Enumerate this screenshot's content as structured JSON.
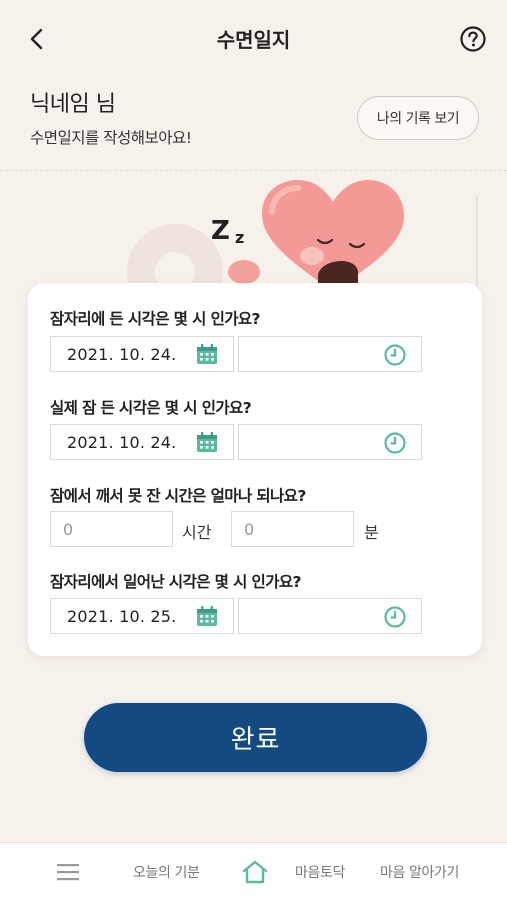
{
  "header": {
    "title": "수면일지"
  },
  "user": {
    "nickname": "닉네임 님",
    "subtitle": "수면일지를 작성해보아요!"
  },
  "records_button": "나의 기록 보기",
  "illustration": {
    "sleep_letters": [
      "Z",
      "z"
    ]
  },
  "form": {
    "q1": {
      "label": "잠자리에 든 시각은 몇 시 인가요?",
      "date": "2021. 10. 24.",
      "time": ""
    },
    "q2": {
      "label": "실제 잠 든 시각은 몇 시 인가요?",
      "date": "2021. 10. 24.",
      "time": ""
    },
    "q3": {
      "label": "잠에서 깨서 못 잔 시간은 얼마나 되나요?",
      "hours_placeholder": "0",
      "hours_unit": "시간",
      "minutes_placeholder": "0",
      "minutes_unit": "분"
    },
    "q4": {
      "label": "잠자리에서 일어난 시각은 몇 시 인가요?",
      "date": "2021. 10. 25.",
      "time": ""
    }
  },
  "complete_button": "완료",
  "bottom_nav": {
    "items": [
      {
        "label": "오늘의 기분"
      },
      {
        "label": "마음토닥"
      },
      {
        "label": "마음 알아가기"
      }
    ]
  },
  "colors": {
    "accent_teal": "#5bb9a1",
    "primary_navy": "#134a82",
    "background": "#f7f1ec",
    "heart_pink": "#f39a96"
  }
}
